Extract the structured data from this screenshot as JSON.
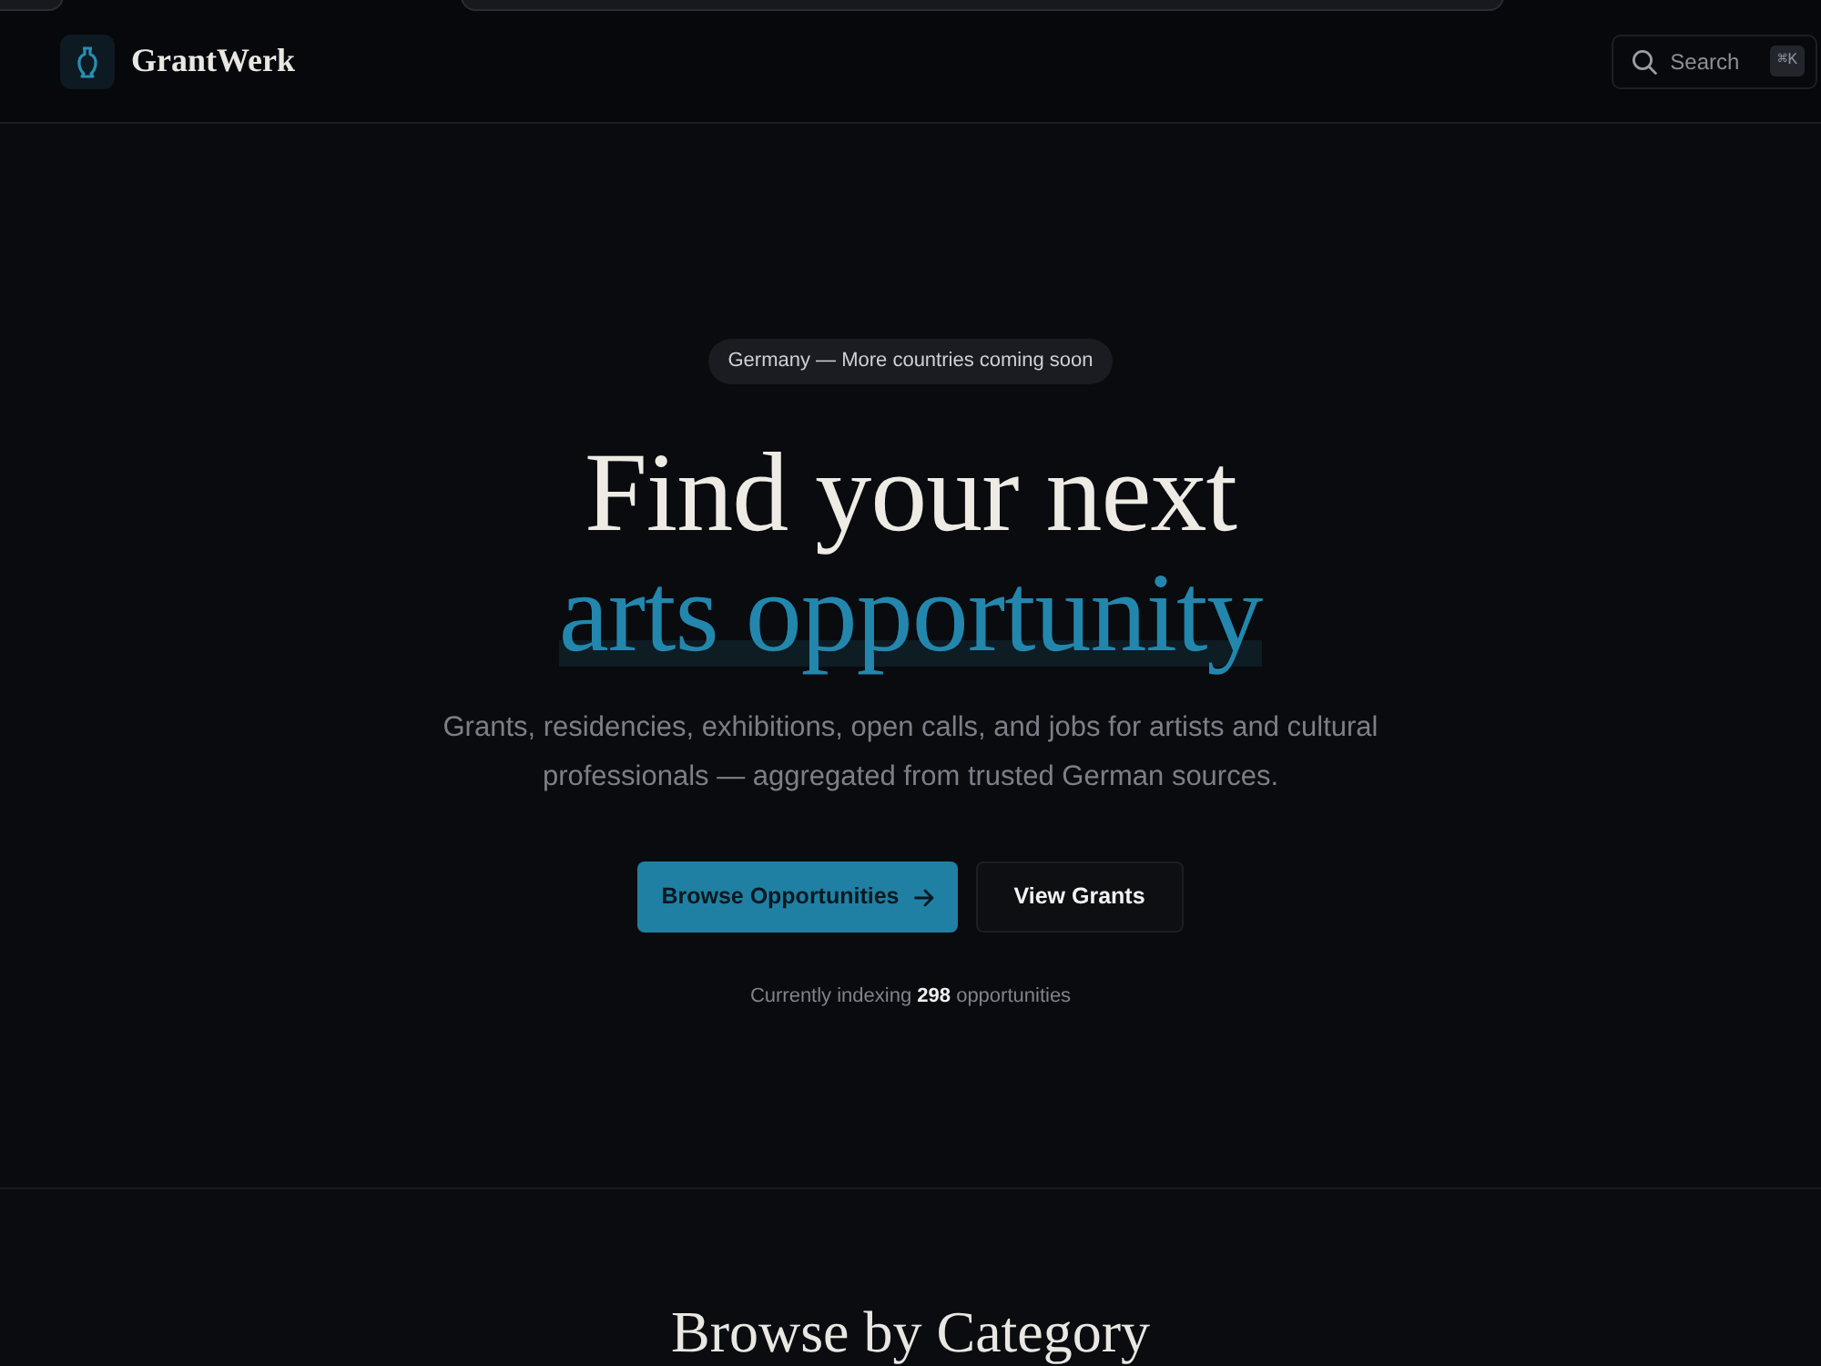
{
  "header": {
    "logo": {
      "text": "GrantWerk"
    },
    "search": {
      "label": "Search",
      "shortcut": "⌘K"
    }
  },
  "hero": {
    "badge": "Germany — More countries coming soon",
    "title_lines": [
      {
        "text": "Find your next",
        "kind": "plain"
      },
      {
        "text": "arts opportunity",
        "kind": "accent"
      }
    ],
    "description": "Grants, residencies, exhibitions, open calls, and jobs for artists and cultural professionals — aggregated from trusted German sources.",
    "buttons": [
      {
        "label": "Browse Opportunities",
        "kind": "primary"
      },
      {
        "label": "View Grants",
        "kind": "secondary"
      }
    ],
    "index_note": "Currently indexing **298** opportunities"
  },
  "categories": {
    "title": "Browse by Category"
  }
}
